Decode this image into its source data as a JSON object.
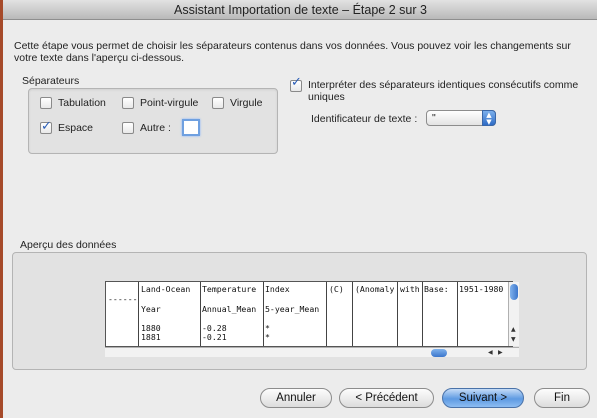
{
  "window": {
    "title": "Assistant Importation de texte – Étape 2 sur 3"
  },
  "intro_text": "Cette étape vous permet de choisir les séparateurs contenus dans vos données. Vous pouvez voir les changements sur votre texte dans l'aperçu ci-dessous.",
  "separators": {
    "label": "Séparateurs",
    "tab": {
      "label": "Tabulation",
      "checked": false
    },
    "semicolon": {
      "label": "Point-virgule",
      "checked": false
    },
    "comma": {
      "label": "Virgule",
      "checked": false
    },
    "space": {
      "label": "Espace",
      "checked": true
    },
    "other": {
      "label": "Autre :",
      "checked": false,
      "value": ""
    }
  },
  "consecutive": {
    "label": "Interpréter des séparateurs identiques consécutifs comme uniques",
    "checked": true
  },
  "text_qualifier": {
    "label": "Identificateur de texte :",
    "value": "\""
  },
  "preview": {
    "label": "Aperçu des données",
    "rows": [
      [
        "Land-Ocean",
        "Temperature",
        "Index",
        "(C)",
        "(Anomaly",
        "with",
        "Base:",
        "1951-1980"
      ],
      [
        "------",
        "",
        "",
        "",
        "",
        "",
        "",
        ""
      ],
      [
        "Year",
        "Annual_Mean",
        "5-year_Mean",
        "",
        "",
        "",
        "",
        ""
      ],
      [
        "",
        "",
        "",
        "",
        "",
        "",
        "",
        ""
      ],
      [
        "1880",
        "-0.28",
        "*",
        "",
        "",
        "",
        "",
        ""
      ],
      [
        "1881",
        "-0.21",
        "*",
        "",
        "",
        "",
        "",
        ""
      ]
    ]
  },
  "buttons": {
    "cancel": "Annuler",
    "previous": "< Précédent",
    "next": "Suivant >",
    "finish": "Fin"
  }
}
